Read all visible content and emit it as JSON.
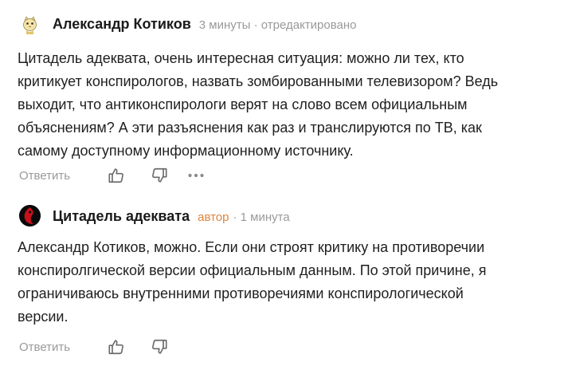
{
  "comments": [
    {
      "author": "Александр Котиков",
      "meta": "3 минуты · отредактировано",
      "paragraphs": [
        "Цитадель адеквата, очень интересная ситуация: можно ли тех, кто",
        "критикует конспирологов, назвать зомбированными телевизором? Ведь",
        "выходит, что антиконспирологи верят на слово всем официальным",
        "объяснениям? А эти разъяснения как раз и транслируются по ТВ, как",
        "самому доступному информационному источнику."
      ],
      "reply_label": "Ответить",
      "avatar_icon": "cat-avatar-icon"
    },
    {
      "author": "Цитадель адеквата",
      "badge": "автор",
      "meta": "· 1 минута",
      "paragraphs": [
        "Александр Котиков, можно. Если они строят критику на противоречии",
        "конспиролгической версии официальным данным. По этой причине, я",
        "ограничиваюсь внутренними противоречиями конспирологической",
        "версии."
      ],
      "reply_label": "Ответить",
      "avatar_icon": "red-black-avatar-icon"
    }
  ],
  "colors": {
    "author_badge": "#e0843a",
    "meta_gray": "#9a9a9a",
    "text": "#1f1f1f"
  },
  "icons": {
    "like": "thumbs-up-icon",
    "dislike": "thumbs-down-icon",
    "more": "more-dots-icon"
  }
}
